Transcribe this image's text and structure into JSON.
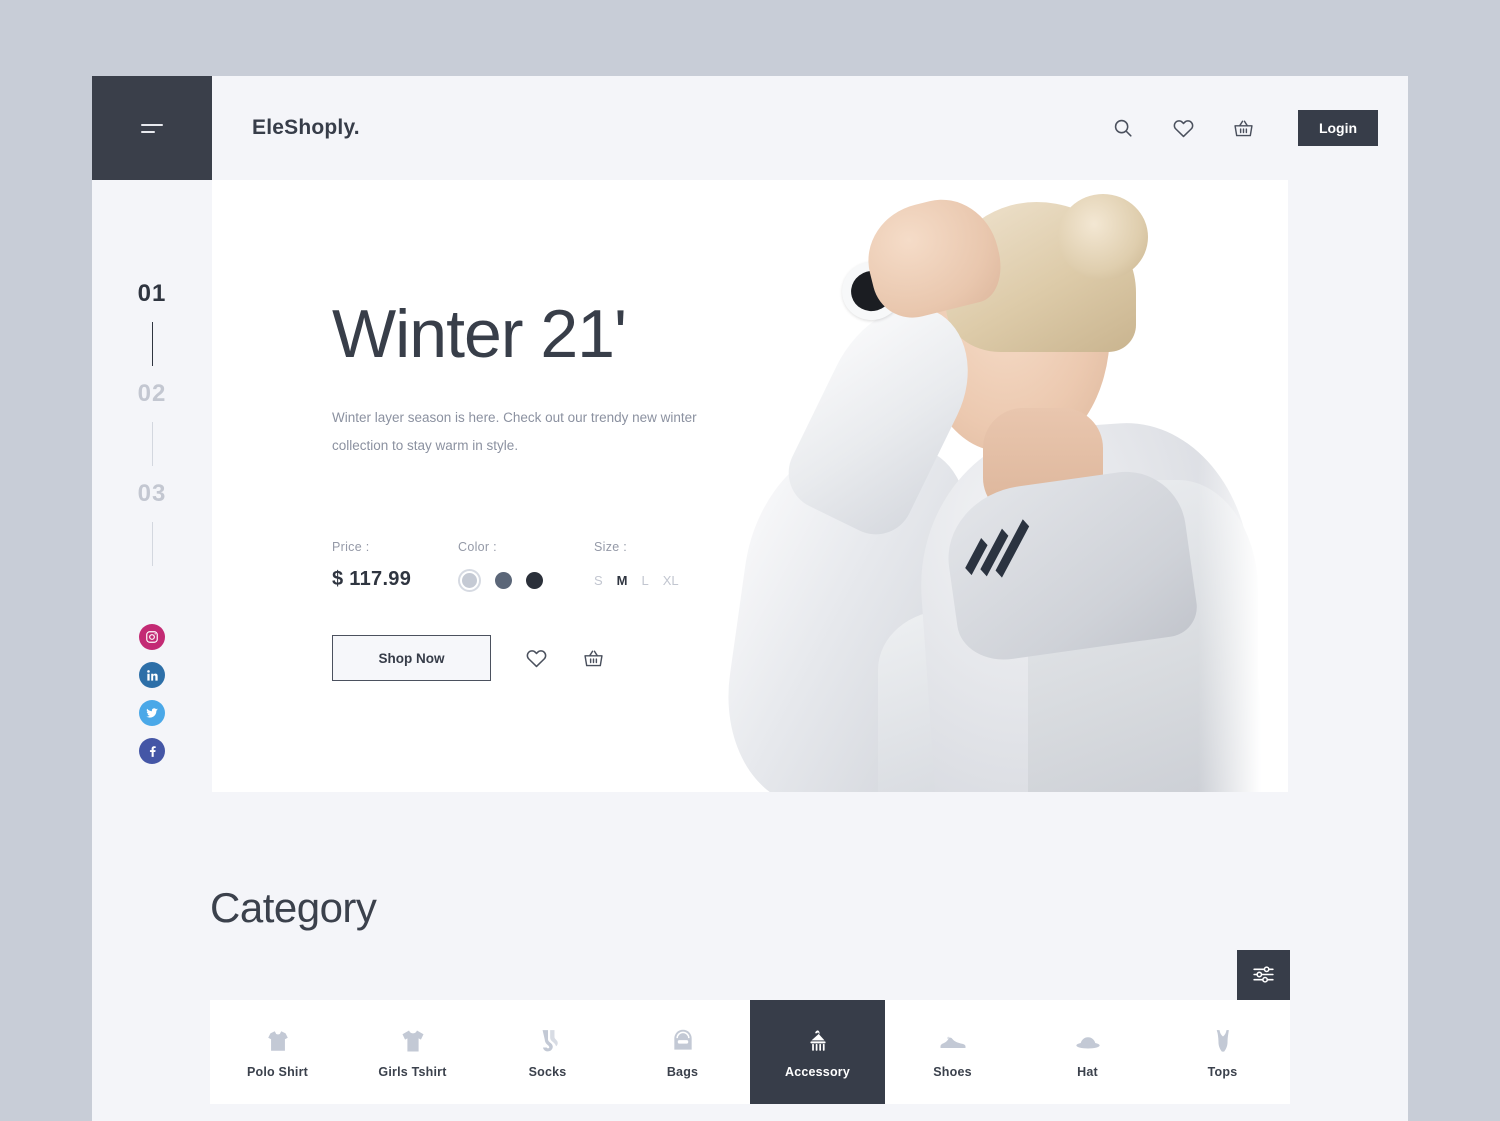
{
  "brand": "EleShoply.",
  "header": {
    "icons": [
      "search-icon",
      "heart-icon",
      "basket-icon"
    ],
    "login_label": "Login"
  },
  "slides": [
    {
      "num": "01",
      "active": true
    },
    {
      "num": "02",
      "active": false
    },
    {
      "num": "03",
      "active": false
    }
  ],
  "socials": [
    {
      "name": "instagram",
      "color": "#c32a74"
    },
    {
      "name": "linkedin",
      "color": "#2d6fa8"
    },
    {
      "name": "twitter",
      "color": "#4aa8e8"
    },
    {
      "name": "facebook",
      "color": "#4456a6"
    }
  ],
  "hero": {
    "title": "Winter 21'",
    "subtitle": "Winter layer season is here. Check out our trendy new winter collection to stay warm in style.",
    "price_label": "Price :",
    "price_value": "$ 117.99",
    "color_label": "Color :",
    "colors": [
      {
        "hex": "#c5cad4",
        "selected": true
      },
      {
        "hex": "#5b6678",
        "selected": false
      },
      {
        "hex": "#2b303a",
        "selected": false
      }
    ],
    "size_label": "Size :",
    "sizes": [
      {
        "label": "S",
        "active": false
      },
      {
        "label": "M",
        "active": true
      },
      {
        "label": "L",
        "active": false
      },
      {
        "label": "XL",
        "active": false
      }
    ],
    "shop_label": "Shop Now"
  },
  "category": {
    "title": "Category",
    "items": [
      {
        "label": "Polo Shirt",
        "icon": "polo-shirt-icon",
        "active": false
      },
      {
        "label": "Girls Tshirt",
        "icon": "tshirt-icon",
        "active": false
      },
      {
        "label": "Socks",
        "icon": "socks-icon",
        "active": false
      },
      {
        "label": "Bags",
        "icon": "bag-icon",
        "active": false
      },
      {
        "label": "Accessory",
        "icon": "hanger-icon",
        "active": true
      },
      {
        "label": "Shoes",
        "icon": "shoe-icon",
        "active": false
      },
      {
        "label": "Hat",
        "icon": "hat-icon",
        "active": false
      },
      {
        "label": "Tops",
        "icon": "top-icon",
        "active": false
      }
    ]
  },
  "colors": {
    "page_bg": "#c8cdd7",
    "app_bg": "#f4f5f9",
    "dark": "#373d49",
    "card": "#ffffff",
    "muted_text": "#8b91a0"
  }
}
